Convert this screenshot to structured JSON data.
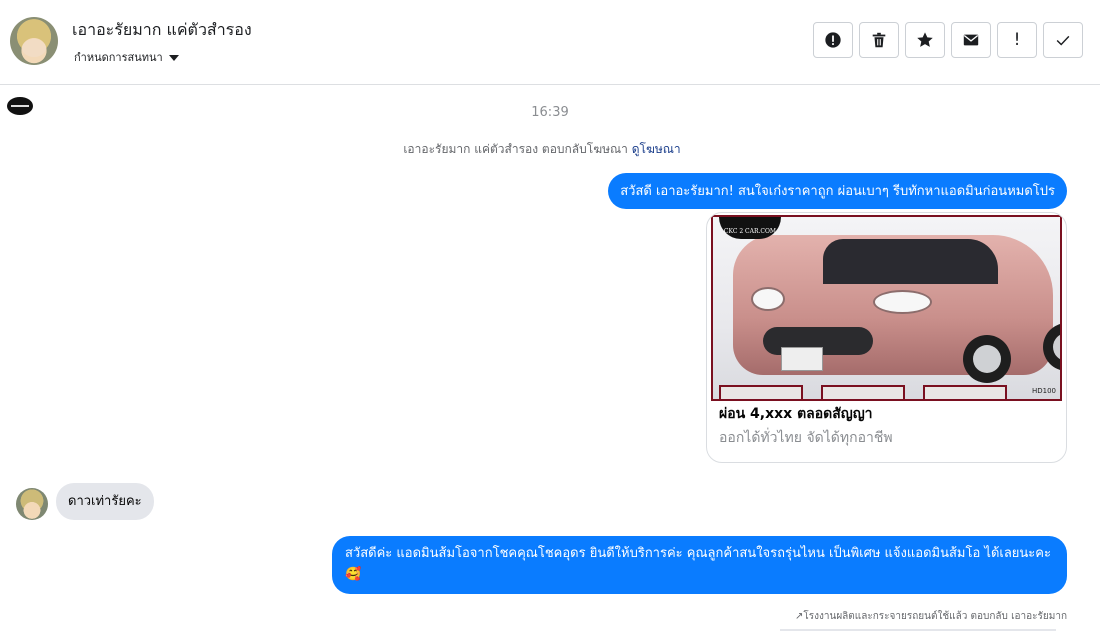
{
  "header": {
    "name": "เอาอะรัยมาก แค่ตัวสำรอง",
    "subtitle": "กำหนดการสนทนา"
  },
  "toolbar": {
    "buttons": [
      {
        "icon": "alert-circle-icon"
      },
      {
        "icon": "trash-icon"
      },
      {
        "icon": "star-icon"
      },
      {
        "icon": "envelope-icon"
      },
      {
        "icon": "exclamation-icon",
        "glyph": "!"
      },
      {
        "icon": "checkmark-icon"
      }
    ]
  },
  "conversation": {
    "time": "16:39",
    "ad_note": "เอาอะรัยมาก แค่ตัวสำรอง ตอบกลับโฆษณา",
    "ad_link": "ดูโฆษณา",
    "messages": {
      "greeting": "สวัสดี เอาอะรัยมาก! สนใจเก๋งราคาถูก ผ่อนเบาๆ รีบทักหาแอดมินก่อนหมดโปร",
      "customer": "ดาวเท่ารัยคะ",
      "admin_reply": "สวัสดีค่ะ แอดมินส้มโอจากโชคคุณโชคอุดร ยินดีให้บริการค่ะ   คุณลูกค้าสนใจรถรุ่นไหน เป็นพิเศษ แจ้งแอดมินส้มโอ ได้เลยนะคะ🥰"
    },
    "ad_card": {
      "title": "ผ่อน 4,xxx ตลอดสัญญา",
      "subtitle": "ออกได้ทั่วไทย จัดได้ทุกอาชีพ",
      "image_brand": "CKC 2 CAR.COM",
      "image_code": "HD100"
    },
    "reply_note": "↗โรงงานผลิตและกระจายรถยนต์ใช้แล้ว ตอบกลับ เอาอะรัยมาก"
  },
  "colors": {
    "outgoing_bubble": "#0a7cff",
    "incoming_bubble": "#e4e6eb",
    "link": "#1c3f8c"
  }
}
